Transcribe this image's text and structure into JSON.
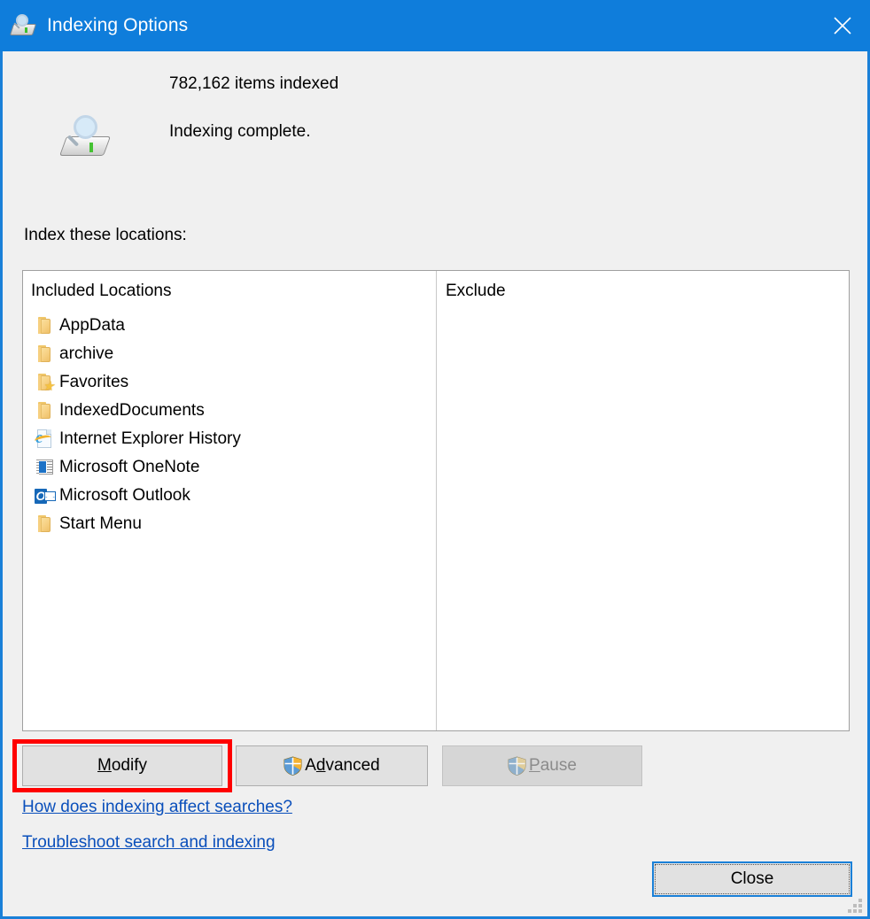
{
  "window": {
    "title": "Indexing Options",
    "title_icon": "indexing-drive-search-icon",
    "close_icon": "close-x-icon",
    "accent_color": "#0f7ddb",
    "body_color": "#f0f0f0"
  },
  "status": {
    "icon": "indexing-drive-search-icon",
    "items_indexed": "782,162 items indexed",
    "state": "Indexing complete."
  },
  "locations": {
    "label": "Index these locations:",
    "columns": [
      "Included Locations",
      "Exclude"
    ],
    "items": [
      {
        "label": "AppData",
        "icon": "folder-icon",
        "exclude": ""
      },
      {
        "label": "archive",
        "icon": "folder-icon",
        "exclude": ""
      },
      {
        "label": "Favorites",
        "icon": "folder-favorites-icon",
        "exclude": ""
      },
      {
        "label": "IndexedDocuments",
        "icon": "folder-icon",
        "exclude": ""
      },
      {
        "label": "Internet Explorer History",
        "icon": "internet-explorer-icon",
        "exclude": ""
      },
      {
        "label": "Microsoft OneNote",
        "icon": "onenote-icon",
        "exclude": ""
      },
      {
        "label": "Microsoft Outlook",
        "icon": "outlook-icon",
        "exclude": ""
      },
      {
        "label": "Start Menu",
        "icon": "folder-icon",
        "exclude": ""
      }
    ]
  },
  "buttons": {
    "modify": {
      "label_pre": "",
      "accel": "M",
      "label_post": "odify",
      "enabled": true,
      "shield": false,
      "highlighted": true
    },
    "advanced": {
      "label_pre": "A",
      "accel": "d",
      "label_post": "vanced",
      "enabled": true,
      "shield": true,
      "highlighted": false
    },
    "pause": {
      "label_pre": "",
      "accel": "P",
      "label_post": "ause",
      "enabled": false,
      "shield": true,
      "highlighted": false
    },
    "close": {
      "label": "Close",
      "enabled": true,
      "focused": true
    }
  },
  "links": [
    {
      "label": "How does indexing affect searches?"
    },
    {
      "label": "Troubleshoot search and indexing"
    }
  ],
  "annotation": {
    "color": "#ff0000",
    "target": "modify-button"
  },
  "resize_grip_icon": "resize-grip-icon"
}
